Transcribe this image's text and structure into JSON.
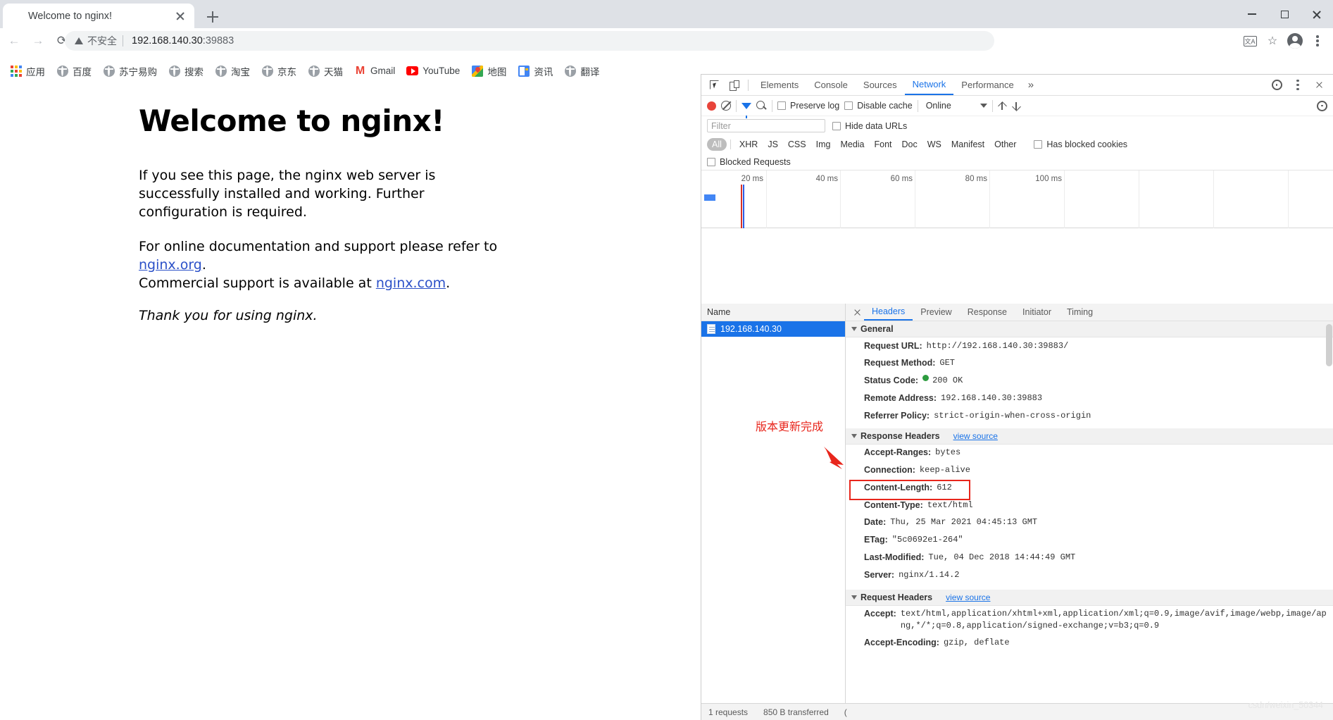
{
  "browser": {
    "tab": {
      "title": "Welcome to nginx!",
      "favicon": "globe-icon",
      "close": "×"
    },
    "new_tab_label": "+",
    "window_controls": {
      "minimize": "–",
      "maximize": "□",
      "close": "×"
    },
    "nav": {
      "back": "←",
      "forward": "→",
      "reload": "C"
    },
    "omnibox": {
      "security_label": "不安全",
      "url_host": "192.168.140.30",
      "url_port": ":39883",
      "full_url": "192.168.140.30:39883"
    },
    "toolbar_icons": [
      "translate-icon",
      "bookmark-star-icon",
      "profile-avatar-icon",
      "menu-kebab-icon"
    ],
    "translate_glyph": "文A",
    "star_glyph": "☆",
    "bookmarks": [
      {
        "label": "应用",
        "icon": "apps-grid-icon"
      },
      {
        "label": "百度",
        "icon": "globe-icon"
      },
      {
        "label": "苏宁易购",
        "icon": "globe-icon"
      },
      {
        "label": "搜索",
        "icon": "globe-icon"
      },
      {
        "label": "淘宝",
        "icon": "globe-icon"
      },
      {
        "label": "京东",
        "icon": "globe-icon"
      },
      {
        "label": "天猫",
        "icon": "globe-icon"
      },
      {
        "label": "Gmail",
        "icon": "gmail-icon"
      },
      {
        "label": "YouTube",
        "icon": "youtube-icon"
      },
      {
        "label": "地图",
        "icon": "google-maps-icon"
      },
      {
        "label": "资讯",
        "icon": "google-news-icon"
      },
      {
        "label": "翻译",
        "icon": "globe-icon"
      }
    ]
  },
  "page": {
    "heading": "Welcome to nginx!",
    "para1": "If you see this page, the nginx web server is successfully installed and working. Further configuration is required.",
    "para2_prefix": "For online documentation and support please refer to ",
    "link1": "nginx.org",
    "para2_mid": ".",
    "para2_line2": "Commercial support is available at ",
    "link2": "nginx.com",
    "para2_suffix": ".",
    "thanks": "Thank you for using nginx."
  },
  "devtools": {
    "tabs": [
      {
        "label": "Elements",
        "active": false
      },
      {
        "label": "Console",
        "active": false
      },
      {
        "label": "Sources",
        "active": false
      },
      {
        "label": "Network",
        "active": true
      },
      {
        "label": "Performance",
        "active": false
      }
    ],
    "more_tabs": "»",
    "settings_icon": "gear-icon",
    "kebab_icon": "menu-kebab-icon",
    "close_icon": "close-icon",
    "inspect_icon": "inspect-element-icon",
    "device_icon": "device-toolbar-icon",
    "network_toolbar": {
      "record_icon": "record-button",
      "clear_icon": "clear-icon",
      "filter_icon": "filter-funnel-icon",
      "search_icon": "search-icon",
      "preserve_log": "Preserve log",
      "disable_cache": "Disable cache",
      "throttling": "Online",
      "import_icon": "import-har-icon",
      "export_icon": "export-har-icon",
      "settings_icon": "network-settings-icon"
    },
    "filter": {
      "placeholder": "Filter",
      "hide_data_urls": "Hide data URLs",
      "types": [
        "All",
        "XHR",
        "JS",
        "CSS",
        "Img",
        "Media",
        "Font",
        "Doc",
        "WS",
        "Manifest",
        "Other"
      ],
      "active_type": "All",
      "has_blocked_cookies": "Has blocked cookies",
      "blocked_requests": "Blocked Requests"
    },
    "timeline": {
      "ticks": [
        "20 ms",
        "40 ms",
        "60 ms",
        "80 ms",
        "100 ms"
      ]
    },
    "request_list": {
      "column_header": "Name",
      "rows": [
        {
          "name": "192.168.140.30",
          "icon": "document-icon",
          "selected": true
        }
      ]
    },
    "detail_tabs": [
      {
        "label": "Headers",
        "active": true
      },
      {
        "label": "Preview",
        "active": false
      },
      {
        "label": "Response",
        "active": false
      },
      {
        "label": "Initiator",
        "active": false
      },
      {
        "label": "Timing",
        "active": false
      }
    ],
    "sections": [
      {
        "title": "General",
        "view_source": "",
        "rows": [
          {
            "key": "Request URL:",
            "value": "http://192.168.140.30:39883/"
          },
          {
            "key": "Request Method:",
            "value": "GET"
          },
          {
            "key": "Status Code:",
            "value": "200  OK",
            "status_dot": "#2d9c3f"
          },
          {
            "key": "Remote Address:",
            "value": "192.168.140.30:39883"
          },
          {
            "key": "Referrer Policy:",
            "value": "strict-origin-when-cross-origin"
          }
        ]
      },
      {
        "title": "Response Headers",
        "view_source": "view source",
        "rows": [
          {
            "key": "Accept-Ranges:",
            "value": "bytes"
          },
          {
            "key": "Connection:",
            "value": "keep-alive"
          },
          {
            "key": "Content-Length:",
            "value": "612"
          },
          {
            "key": "Content-Type:",
            "value": "text/html"
          },
          {
            "key": "Date:",
            "value": "Thu, 25 Mar 2021 04:45:13 GMT"
          },
          {
            "key": "ETag:",
            "value": "\"5c0692e1-264\""
          },
          {
            "key": "Last-Modified:",
            "value": "Tue, 04 Dec 2018 14:44:49 GMT"
          },
          {
            "key": "Server:",
            "value": "nginx/1.14.2",
            "highlighted": true
          }
        ]
      },
      {
        "title": "Request Headers",
        "view_source": "view source",
        "rows": [
          {
            "key": "Accept:",
            "value": "text/html,application/xhtml+xml,application/xml;q=0.9,image/avif,image/webp,image/apng,*/*;q=0.8,application/signed-exchange;v=b3;q=0.9"
          },
          {
            "key": "Accept-Encoding:",
            "value": "gzip, deflate"
          }
        ]
      }
    ],
    "status_bar": {
      "requests": "1 requests",
      "transferred": "850 B transferred",
      "resources": "("
    }
  },
  "annotation": {
    "text": "版本更新完成",
    "color": "#e8261c",
    "arrow": "red-arrow",
    "highlight_box": "red-rectangle-around-server-header"
  },
  "watermark": "csdn/weixin_50344"
}
